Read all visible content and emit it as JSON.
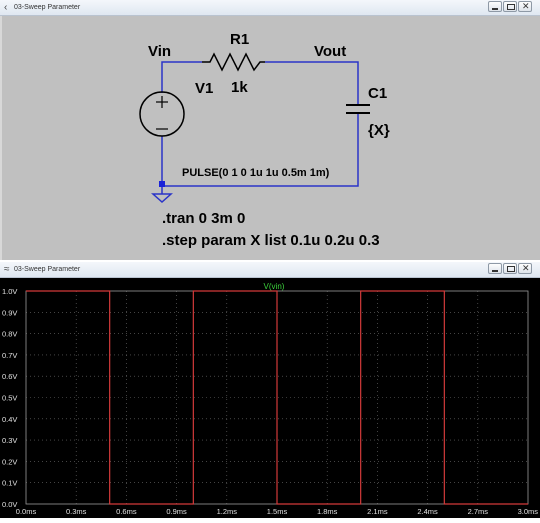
{
  "schematic_window": {
    "title": "03-Sweep Parameter",
    "labels": {
      "vin": "Vin",
      "r1_name": "R1",
      "r1_value": "1k",
      "vout": "Vout",
      "v1_name": "V1",
      "c1_name": "C1",
      "c1_value": "{X}",
      "source_value": "PULSE(0 1 0 1u 1u 0.5m 1m)",
      "directive_tran": ".tran 0 3m 0",
      "directive_step": ".step param X list 0.1u 0.2u 0.3"
    },
    "colors": {
      "wire": "#2a34c8",
      "background": "#c0c0c0",
      "node": "#1a22d8"
    }
  },
  "plot_window": {
    "title": "03-Sweep Parameter",
    "trace_label": "V(vin)",
    "colors": {
      "background": "#000000",
      "trace": "#d23a3a",
      "trace_label": "#3cd23c",
      "axis_text": "#e0e0e0",
      "grid": "#6e6e6e"
    }
  },
  "chart_data": {
    "type": "line",
    "title": "V(vin)",
    "xlabel": "",
    "ylabel": "",
    "xlim": [
      0,
      3.0
    ],
    "ylim": [
      0,
      1.0
    ],
    "x_ticks": [
      "0.0ms",
      "0.3ms",
      "0.6ms",
      "0.9ms",
      "1.2ms",
      "1.5ms",
      "1.8ms",
      "2.1ms",
      "2.4ms",
      "2.7ms",
      "3.0ms"
    ],
    "y_ticks": [
      "0.0V",
      "0.1V",
      "0.2V",
      "0.3V",
      "0.4V",
      "0.5V",
      "0.6V",
      "0.7V",
      "0.8V",
      "0.9V",
      "1.0V"
    ],
    "x_tick_values": [
      0,
      0.3,
      0.6,
      0.9,
      1.2,
      1.5,
      1.8,
      2.1,
      2.4,
      2.7,
      3.0
    ],
    "y_tick_values": [
      0,
      0.1,
      0.2,
      0.3,
      0.4,
      0.5,
      0.6,
      0.7,
      0.8,
      0.9,
      1.0
    ],
    "series": [
      {
        "name": "V(vin)",
        "x": [
          0,
          0.5,
          0.5,
          1.0,
          1.0,
          1.5,
          1.5,
          2.0,
          2.0,
          2.5,
          2.5,
          3.0
        ],
        "y": [
          1,
          1,
          0,
          0,
          1,
          1,
          0,
          0,
          1,
          1,
          0,
          0
        ]
      }
    ]
  }
}
